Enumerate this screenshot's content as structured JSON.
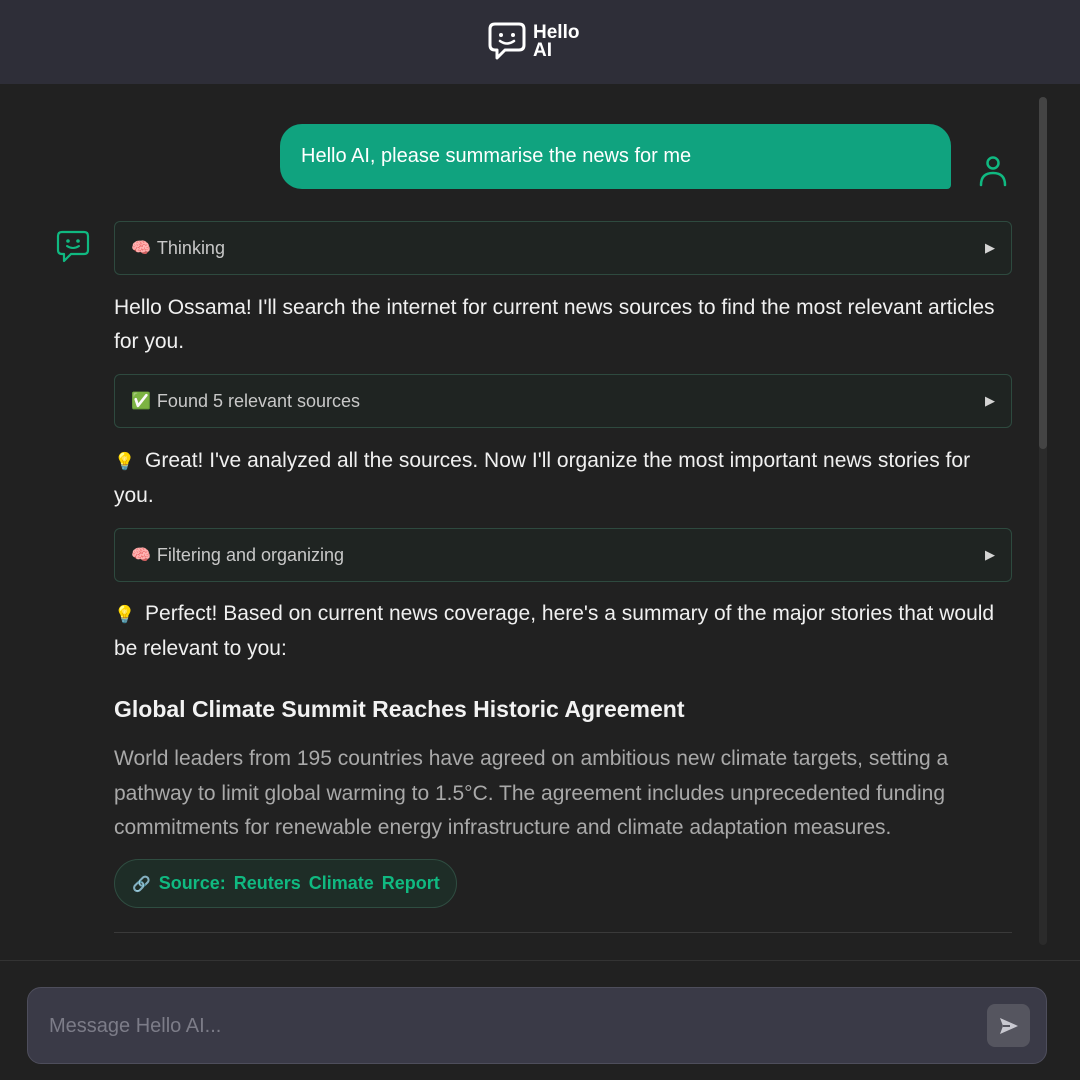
{
  "header": {
    "logo_text": "Hello AI",
    "logo_icon": "chat-smile-icon"
  },
  "user_message": {
    "text": "Hello AI, please summarise the news for me",
    "avatar_icon": "user-icon"
  },
  "assistant": {
    "avatar_icon": "chat-smile-icon",
    "blocks": {
      "thinking": {
        "emoji": "🧠",
        "label": "Thinking",
        "icon": "brain-icon"
      },
      "para1": {
        "text": "Hello Ossama! I'll search the internet for current news sources to find the most relevant articles for you."
      },
      "sources": {
        "emoji": "✅",
        "label": "Found 5 relevant sources",
        "icon": "check-icon"
      },
      "para2": {
        "emoji": "💡",
        "text": "Great! I've analyzed all the sources. Now I'll organize the most important news stories for you."
      },
      "filtering": {
        "emoji": "🧠",
        "label": "Filtering and organizing",
        "icon": "brain-icon"
      },
      "para3": {
        "emoji": "💡",
        "text": "Perfect! Based on current news coverage, here's a summary of the major stories that would be relevant to you:"
      }
    },
    "news": {
      "title": "Global Climate Summit Reaches Historic Agreement",
      "body": "World leaders from 195 countries have agreed on ambitious new climate targets, setting a pathway to limit global warming to 1.5°C. The agreement includes unprecedented funding commitments for renewable energy infrastructure and climate adaptation measures.",
      "source_icon": "🔗",
      "source_label": "Source: Reuters Climate Report"
    }
  },
  "composer": {
    "placeholder": "Message Hello AI...",
    "send_icon": "send-icon"
  },
  "colors": {
    "accent": "#10a37f",
    "header_bg": "#2e2e38",
    "chat_bg": "#212121"
  }
}
